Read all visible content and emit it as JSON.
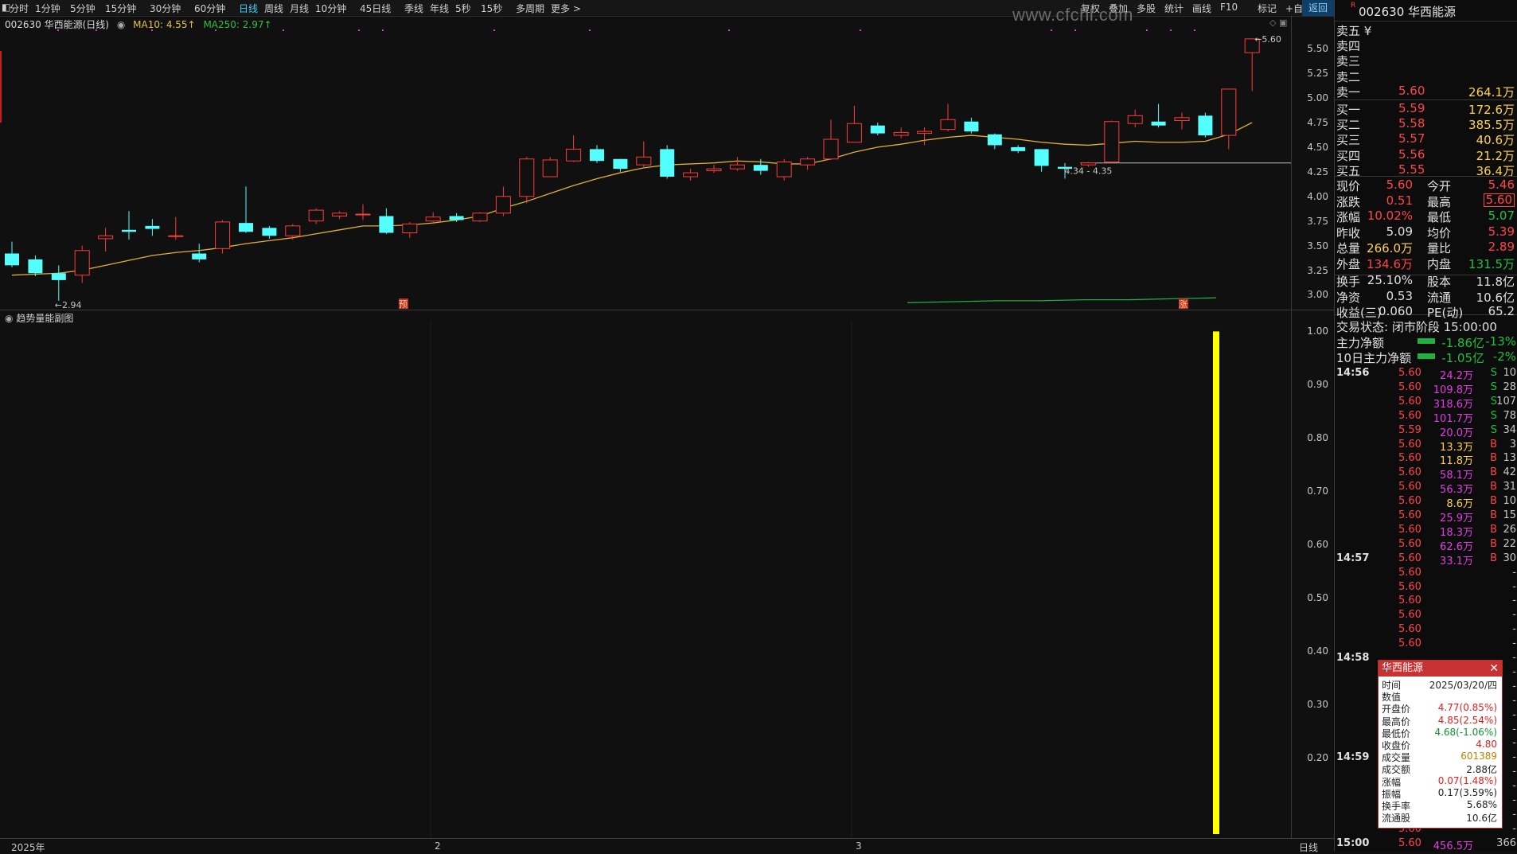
{
  "toolbar": {
    "periods": [
      "分时",
      "1分钟",
      "5分钟",
      "15分钟",
      "30分钟",
      "60分钟",
      "日线",
      "周线",
      "月线",
      "10分钟",
      "45日线",
      "季线",
      "年线",
      "5秒",
      "15秒",
      "多周期",
      "更多 >"
    ],
    "active_period": "日线",
    "right_tools": [
      "复权",
      "叠加",
      "多股",
      "统计",
      "画线",
      "F10",
      "标记",
      "+自选"
    ],
    "return_label": "返回",
    "watermark": "www.cfchi.com"
  },
  "chart_header": {
    "title": "002630 华西能源(日线)",
    "ma10": "MA10: 4.55↑",
    "ma250": "MA250: 2.97↑"
  },
  "main_chart": {
    "price_ticks": [
      "5.50",
      "5.25",
      "5.00",
      "4.75",
      "4.50",
      "4.25",
      "4.00",
      "3.75",
      "3.50",
      "3.25",
      "3.00"
    ],
    "low_marker": "←2.94",
    "high_marker": "←5.60",
    "range_label": "4.34 - 4.35",
    "event_markers": [
      "预",
      "涨"
    ]
  },
  "chart_data": {
    "type": "candlestick",
    "ylim": [
      2.85,
      5.72
    ],
    "candles": [
      [
        3.42,
        3.3,
        3.54,
        3.28
      ],
      [
        3.36,
        3.22,
        3.4,
        3.19
      ],
      [
        3.22,
        3.15,
        3.3,
        2.94
      ],
      [
        3.2,
        3.45,
        3.5,
        3.12
      ],
      [
        3.57,
        3.6,
        3.68,
        3.44
      ],
      [
        3.66,
        3.64,
        3.85,
        3.56
      ],
      [
        3.7,
        3.67,
        3.77,
        3.6
      ],
      [
        3.6,
        3.6,
        3.79,
        3.56
      ],
      [
        3.42,
        3.36,
        3.52,
        3.33
      ],
      [
        3.47,
        3.74,
        3.76,
        3.42
      ],
      [
        3.73,
        3.64,
        4.1,
        3.63
      ],
      [
        3.68,
        3.6,
        3.7,
        3.57
      ],
      [
        3.6,
        3.7,
        3.72,
        3.56
      ],
      [
        3.75,
        3.86,
        3.88,
        3.72
      ],
      [
        3.8,
        3.83,
        3.85,
        3.77
      ],
      [
        3.82,
        3.82,
        3.92,
        3.76
      ],
      [
        3.8,
        3.63,
        3.88,
        3.62
      ],
      [
        3.63,
        3.72,
        3.74,
        3.58
      ],
      [
        3.75,
        3.79,
        3.84,
        3.72
      ],
      [
        3.8,
        3.76,
        3.83,
        3.74
      ],
      [
        3.75,
        3.83,
        3.84,
        3.74
      ],
      [
        3.83,
        4.0,
        4.1,
        3.8
      ],
      [
        4.0,
        4.38,
        4.4,
        3.93
      ],
      [
        4.2,
        4.37,
        4.4,
        4.2
      ],
      [
        4.36,
        4.48,
        4.62,
        4.35
      ],
      [
        4.48,
        4.36,
        4.52,
        4.34
      ],
      [
        4.38,
        4.28,
        4.38,
        4.25
      ],
      [
        4.32,
        4.4,
        4.56,
        4.3
      ],
      [
        4.48,
        4.2,
        4.52,
        4.18
      ],
      [
        4.2,
        4.24,
        4.28,
        4.16
      ],
      [
        4.26,
        4.28,
        4.32,
        4.24
      ],
      [
        4.28,
        4.32,
        4.4,
        4.26
      ],
      [
        4.32,
        4.26,
        4.38,
        4.22
      ],
      [
        4.2,
        4.35,
        4.38,
        4.16
      ],
      [
        4.32,
        4.38,
        4.4,
        4.27
      ],
      [
        4.38,
        4.58,
        4.78,
        4.37
      ],
      [
        4.55,
        4.74,
        4.92,
        4.55
      ],
      [
        4.72,
        4.64,
        4.75,
        4.62
      ],
      [
        4.62,
        4.65,
        4.7,
        4.59
      ],
      [
        4.64,
        4.66,
        4.7,
        4.52
      ],
      [
        4.68,
        4.78,
        4.94,
        4.66
      ],
      [
        4.76,
        4.66,
        4.8,
        4.64
      ],
      [
        4.63,
        4.52,
        4.64,
        4.48
      ],
      [
        4.5,
        4.46,
        4.52,
        4.44
      ],
      [
        4.48,
        4.31,
        4.48,
        4.25
      ],
      [
        4.3,
        4.28,
        4.34,
        4.18
      ],
      [
        4.32,
        4.34,
        4.35,
        4.3
      ],
      [
        4.35,
        4.76,
        4.77,
        4.34
      ],
      [
        4.74,
        4.82,
        4.88,
        4.7
      ],
      [
        4.76,
        4.72,
        4.94,
        4.7
      ],
      [
        4.77,
        4.8,
        4.85,
        4.68
      ],
      [
        4.82,
        4.62,
        4.85,
        4.6
      ],
      [
        4.62,
        5.09,
        5.09,
        4.48
      ],
      [
        5.46,
        5.6,
        5.6,
        5.07
      ]
    ],
    "ma10": [
      3.2,
      3.21,
      3.22,
      3.25,
      3.3,
      3.35,
      3.4,
      3.43,
      3.45,
      3.48,
      3.52,
      3.55,
      3.58,
      3.62,
      3.66,
      3.7,
      3.7,
      3.71,
      3.73,
      3.76,
      3.8,
      3.88,
      3.95,
      4.03,
      4.11,
      4.18,
      4.24,
      4.29,
      4.32,
      4.33,
      4.34,
      4.36,
      4.35,
      4.33,
      4.33,
      4.38,
      4.45,
      4.5,
      4.53,
      4.57,
      4.6,
      4.62,
      4.6,
      4.58,
      4.55,
      4.53,
      4.52,
      4.54,
      4.56,
      4.55,
      4.55,
      4.56,
      4.63,
      4.75
    ],
    "ma250_visible": [
      2.92,
      2.93,
      2.94,
      2.94,
      2.95,
      2.95,
      2.96,
      2.97
    ],
    "sub_chart": {
      "title": "趋势量能副图",
      "yticks": [
        "1.00",
        "0.90",
        "0.80",
        "0.70",
        "0.60",
        "0.50",
        "0.40",
        "0.30",
        "0.20"
      ],
      "ylim": [
        0.05,
        1.02
      ],
      "bar_value": 1.0,
      "bar_color": "#ffff00"
    },
    "x_labels": [
      "2025年",
      "2",
      "3"
    ]
  },
  "bottom": {
    "period_label": "日线"
  },
  "right_panel": {
    "code": "002630 华西能源",
    "badge": "R",
    "asks": [
      {
        "label": "卖五 ¥",
        "price": "",
        "vol": ""
      },
      {
        "label": "卖四",
        "price": "",
        "vol": ""
      },
      {
        "label": "卖三",
        "price": "",
        "vol": ""
      },
      {
        "label": "卖二",
        "price": "",
        "vol": ""
      },
      {
        "label": "卖一",
        "price": "5.60",
        "vol": "264.1万"
      }
    ],
    "bids": [
      {
        "label": "买一",
        "price": "5.59",
        "vol": "172.6万"
      },
      {
        "label": "买二",
        "price": "5.58",
        "vol": "385.5万"
      },
      {
        "label": "买三",
        "price": "5.57",
        "vol": "40.6万"
      },
      {
        "label": "买四",
        "price": "5.56",
        "vol": "21.2万"
      },
      {
        "label": "买五",
        "price": "5.55",
        "vol": "36.4万"
      }
    ],
    "quotes": [
      {
        "l1": "现价",
        "v1": "5.60",
        "c1": "red",
        "l2": "今开",
        "v2": "5.46",
        "c2": "red"
      },
      {
        "l1": "涨跌",
        "v1": "0.51",
        "c1": "red",
        "l2": "最高",
        "v2": "5.60",
        "c2": "red"
      },
      {
        "l1": "涨幅",
        "v1": "10.02%",
        "c1": "red",
        "l2": "最低",
        "v2": "5.07",
        "c2": "green"
      },
      {
        "l1": "昨收",
        "v1": "5.09",
        "c1": "white",
        "l2": "均价",
        "v2": "5.39",
        "c2": "red"
      },
      {
        "l1": "总量",
        "v1": "266.0万",
        "c1": "yellow",
        "l2": "量比",
        "v2": "2.89",
        "c2": "red"
      },
      {
        "l1": "外盘",
        "v1": "134.6万",
        "c1": "red",
        "l2": "内盘",
        "v2": "131.5万",
        "c2": "green"
      },
      {
        "l1": "换手",
        "v1": "25.10%",
        "c1": "white",
        "l2": "股本",
        "v2": "11.8亿",
        "c2": "white"
      },
      {
        "l1": "净资",
        "v1": "0.53",
        "c1": "white",
        "l2": "流通",
        "v2": "10.6亿",
        "c2": "white"
      },
      {
        "l1": "收益(三)",
        "v1": "0.060",
        "c1": "white",
        "l2": "PE(动)",
        "v2": "65.2",
        "c2": "white"
      }
    ],
    "trade_status": "交易状态: 闭市阶段 15:00:00",
    "flows": [
      {
        "label": "主力净额",
        "value": "-1.86亿",
        "pct": "-13%"
      },
      {
        "label": "10日主力净额",
        "value": "-1.05亿",
        "pct": "-2%"
      }
    ],
    "ticks": [
      {
        "t": "14:56",
        "p": "5.60",
        "pc": "red",
        "v": "24.2万",
        "vc": "magenta",
        "d": "S",
        "dc": "green",
        "n": "10"
      },
      {
        "t": "",
        "p": "5.60",
        "pc": "red",
        "v": "109.8万",
        "vc": "magenta",
        "d": "S",
        "dc": "green",
        "n": "28"
      },
      {
        "t": "",
        "p": "5.60",
        "pc": "red",
        "v": "318.6万",
        "vc": "magenta",
        "d": "S",
        "dc": "green",
        "n": "107"
      },
      {
        "t": "",
        "p": "5.60",
        "pc": "red",
        "v": "101.7万",
        "vc": "magenta",
        "d": "S",
        "dc": "green",
        "n": "78"
      },
      {
        "t": "",
        "p": "5.59",
        "pc": "red",
        "v": "20.0万",
        "vc": "magenta",
        "d": "S",
        "dc": "green",
        "n": "34"
      },
      {
        "t": "",
        "p": "5.60",
        "pc": "red",
        "v": "13.3万",
        "vc": "yellow",
        "d": "B",
        "dc": "red",
        "n": "3"
      },
      {
        "t": "",
        "p": "5.60",
        "pc": "red",
        "v": "11.8万",
        "vc": "yellow",
        "d": "B",
        "dc": "red",
        "n": "13"
      },
      {
        "t": "",
        "p": "5.60",
        "pc": "red",
        "v": "58.1万",
        "vc": "magenta",
        "d": "B",
        "dc": "red",
        "n": "42"
      },
      {
        "t": "",
        "p": "5.60",
        "pc": "red",
        "v": "56.3万",
        "vc": "magenta",
        "d": "B",
        "dc": "red",
        "n": "31"
      },
      {
        "t": "",
        "p": "5.60",
        "pc": "red",
        "v": "8.6万",
        "vc": "yellow",
        "d": "B",
        "dc": "red",
        "n": "10"
      },
      {
        "t": "",
        "p": "5.60",
        "pc": "red",
        "v": "25.9万",
        "vc": "magenta",
        "d": "B",
        "dc": "red",
        "n": "15"
      },
      {
        "t": "",
        "p": "5.60",
        "pc": "red",
        "v": "18.3万",
        "vc": "magenta",
        "d": "B",
        "dc": "red",
        "n": "26"
      },
      {
        "t": "",
        "p": "5.60",
        "pc": "red",
        "v": "62.6万",
        "vc": "magenta",
        "d": "B",
        "dc": "red",
        "n": "22"
      },
      {
        "t": "14:57",
        "p": "5.60",
        "pc": "red",
        "v": "33.1万",
        "vc": "magenta",
        "d": "B",
        "dc": "red",
        "n": "30"
      },
      {
        "t": "",
        "p": "5.60",
        "pc": "red",
        "v": "",
        "vc": "",
        "d": "",
        "dc": "",
        "n": "-"
      },
      {
        "t": "",
        "p": "5.60",
        "pc": "red",
        "v": "",
        "vc": "",
        "d": "",
        "dc": "",
        "n": "-"
      },
      {
        "t": "",
        "p": "5.60",
        "pc": "red",
        "v": "",
        "vc": "",
        "d": "",
        "dc": "",
        "n": "-"
      },
      {
        "t": "",
        "p": "5.60",
        "pc": "red",
        "v": "",
        "vc": "",
        "d": "",
        "dc": "",
        "n": "-"
      },
      {
        "t": "",
        "p": "5.60",
        "pc": "red",
        "v": "",
        "vc": "",
        "d": "",
        "dc": "",
        "n": "-"
      },
      {
        "t": "",
        "p": "5.60",
        "pc": "red",
        "v": "",
        "vc": "",
        "d": "",
        "dc": "",
        "n": "-"
      },
      {
        "t": "14:58",
        "p": "",
        "pc": "red",
        "v": "",
        "vc": "",
        "d": "",
        "dc": "",
        "n": "-"
      },
      {
        "t": "",
        "p": "",
        "pc": "red",
        "v": "",
        "vc": "",
        "d": "",
        "dc": "",
        "n": "-"
      },
      {
        "t": "",
        "p": "",
        "pc": "red",
        "v": "",
        "vc": "",
        "d": "",
        "dc": "",
        "n": "-"
      },
      {
        "t": "",
        "p": "",
        "pc": "red",
        "v": "",
        "vc": "",
        "d": "",
        "dc": "",
        "n": "-"
      },
      {
        "t": "",
        "p": "",
        "pc": "red",
        "v": "",
        "vc": "",
        "d": "",
        "dc": "",
        "n": "-"
      },
      {
        "t": "",
        "p": "",
        "pc": "red",
        "v": "",
        "vc": "",
        "d": "",
        "dc": "",
        "n": "-"
      },
      {
        "t": "",
        "p": "",
        "pc": "red",
        "v": "",
        "vc": "",
        "d": "",
        "dc": "",
        "n": "-"
      },
      {
        "t": "14:59",
        "p": "",
        "pc": "red",
        "v": "",
        "vc": "",
        "d": "",
        "dc": "",
        "n": "-"
      },
      {
        "t": "",
        "p": "",
        "pc": "red",
        "v": "",
        "vc": "",
        "d": "",
        "dc": "",
        "n": "-"
      },
      {
        "t": "",
        "p": "",
        "pc": "red",
        "v": "",
        "vc": "",
        "d": "",
        "dc": "",
        "n": "-"
      },
      {
        "t": "",
        "p": "",
        "pc": "red",
        "v": "",
        "vc": "",
        "d": "",
        "dc": "",
        "n": "-"
      },
      {
        "t": "",
        "p": "",
        "pc": "red",
        "v": "",
        "vc": "",
        "d": "",
        "dc": "",
        "n": "-"
      },
      {
        "t": "",
        "p": "5.60",
        "pc": "red",
        "v": "",
        "vc": "",
        "d": "",
        "dc": "",
        "n": "-"
      },
      {
        "t": "15:00",
        "p": "5.60",
        "pc": "red",
        "v": "456.5万",
        "vc": "magenta",
        "d": "",
        "dc": "",
        "n": "366"
      }
    ]
  },
  "popup": {
    "title": "华西能源",
    "rows": [
      {
        "l": "时间",
        "v": "2025/03/20/四",
        "c": "#222222"
      },
      {
        "l": "数值",
        "v": "",
        "c": "#222222"
      },
      {
        "l": "开盘价",
        "v": "4.77(0.85%)",
        "c": "#e02020"
      },
      {
        "l": "最高价",
        "v": "4.85(2.54%)",
        "c": "#e02020"
      },
      {
        "l": "最低价",
        "v": "4.68(-1.06%)",
        "c": "#109030"
      },
      {
        "l": "收盘价",
        "v": "4.80",
        "c": "#e02020"
      },
      {
        "l": "成交量",
        "v": "601389",
        "c": "#c08000"
      },
      {
        "l": "成交额",
        "v": "2.88亿",
        "c": "#222222"
      },
      {
        "l": "涨幅",
        "v": "0.07(1.48%)",
        "c": "#e02020"
      },
      {
        "l": "振幅",
        "v": "0.17(3.59%)",
        "c": "#222222"
      },
      {
        "l": "换手率",
        "v": "5.68%",
        "c": "#222222"
      },
      {
        "l": "流通股",
        "v": "10.6亿",
        "c": "#222222"
      }
    ]
  }
}
